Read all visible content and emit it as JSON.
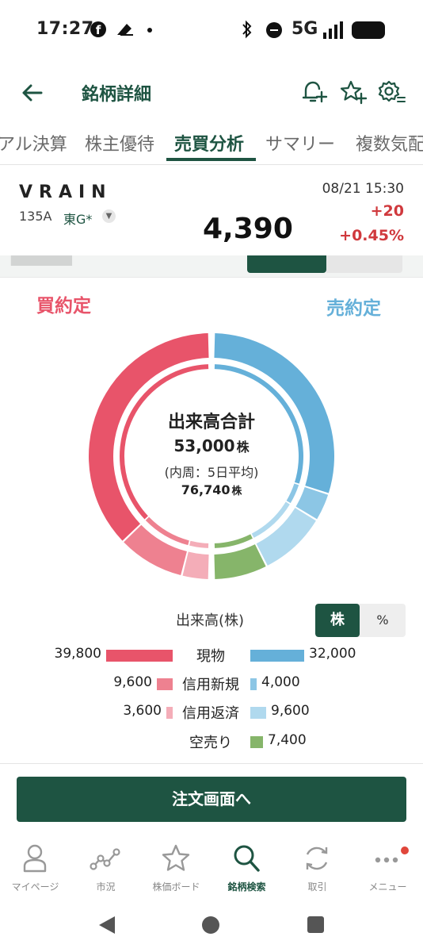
{
  "status_bar": {
    "time": "17:27",
    "network": "5G"
  },
  "header": {
    "title": "銘柄詳細"
  },
  "tabs": [
    {
      "label": "アル決算"
    },
    {
      "label": "株主優待"
    },
    {
      "label": "売買分析"
    },
    {
      "label": "サマリー"
    },
    {
      "label": "複数気配"
    }
  ],
  "stock": {
    "name": "VRAIN",
    "code": "135A",
    "market": "東G*",
    "datetime": "08/21 15:30",
    "price": "4,390",
    "change": "+20",
    "change_pct": "+0.45%"
  },
  "chart": {
    "buy_label": "買約定",
    "sell_label": "売約定",
    "center_title": "出来高合計",
    "total_volume": "53,000",
    "inner_note": "(内周：5日平均)",
    "avg_volume": "76,740",
    "unit": "株",
    "colors": {
      "buy_cash": "#e8546a",
      "buy_margin_new": "#ee8190",
      "buy_margin_repay": "#f4adb8",
      "sell_cash": "#65b0d9",
      "sell_margin_new": "#8cc6e5",
      "sell_margin_repay": "#b0d9ee",
      "short_sell": "#86b56a"
    }
  },
  "chart_data": {
    "type": "pie",
    "title": "出来高合計",
    "series": [
      {
        "name": "現物 (買)",
        "value": 39800
      },
      {
        "name": "信用新規 (買)",
        "value": 9600
      },
      {
        "name": "信用返済 (買)",
        "value": 3600
      },
      {
        "name": "現物 (売)",
        "value": 32000
      },
      {
        "name": "信用新規 (売)",
        "value": 4000
      },
      {
        "name": "信用返済 (売)",
        "value": 9600
      },
      {
        "name": "空売り",
        "value": 7400
      }
    ],
    "total": 53000,
    "inner_ring_average": 76740
  },
  "legend": {
    "title": "出来高(株)",
    "unit_toggle": {
      "shares": "株",
      "percent": "%"
    },
    "rows": [
      {
        "name": "現物",
        "buy": "39,800",
        "sell": "32,000",
        "buy_value": 39800,
        "sell_value": 32000
      },
      {
        "name": "信用新規",
        "buy": "9,600",
        "sell": "4,000",
        "buy_value": 9600,
        "sell_value": 4000
      },
      {
        "name": "信用返済",
        "buy": "3,600",
        "sell": "9,600",
        "buy_value": 3600,
        "sell_value": 9600
      },
      {
        "name": "空売り",
        "buy": "",
        "sell": "7,400",
        "buy_value": 0,
        "sell_value": 7400
      }
    ]
  },
  "order_button": "注文画面へ",
  "bottom_nav": [
    {
      "label": "マイページ",
      "icon": "person-icon"
    },
    {
      "label": "市況",
      "icon": "market-chart-icon"
    },
    {
      "label": "株価ボード",
      "icon": "star-icon"
    },
    {
      "label": "銘柄検索",
      "icon": "search-icon"
    },
    {
      "label": "取引",
      "icon": "refresh-icon"
    },
    {
      "label": "メニュー",
      "icon": "more-icon"
    }
  ]
}
